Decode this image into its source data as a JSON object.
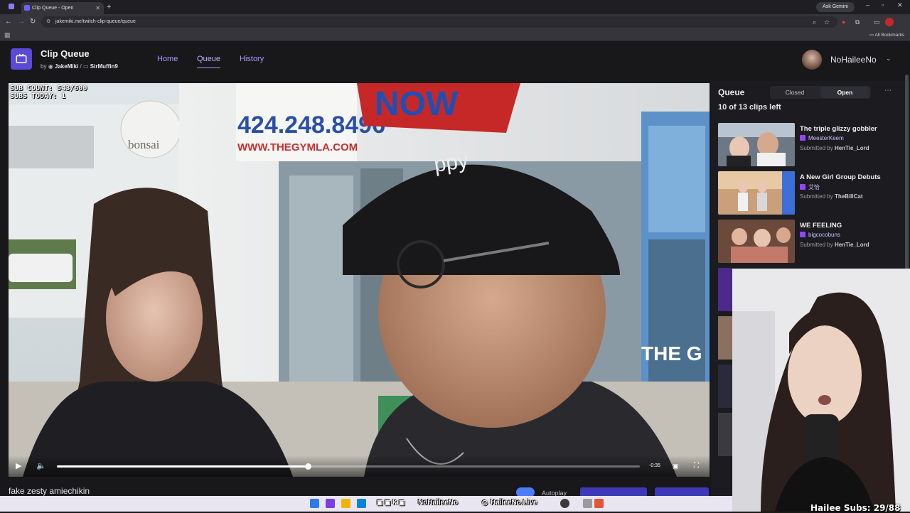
{
  "browser": {
    "tab_title": "Clip Queue - Open",
    "url": "jakemiki.me/twitch-clip-queue/queue",
    "gemini_label": "Ask Gemini",
    "bookmarks_label": "All Bookmarks"
  },
  "app": {
    "title": "Clip Queue",
    "by_prefix": "by",
    "author1": "JakeMiki",
    "separator": "/",
    "author2": "SirMuffin9",
    "nav": [
      "Home",
      "Queue",
      "History"
    ],
    "active_nav": "Queue",
    "username": "NoHaileeNo"
  },
  "video": {
    "overlay_line1": "SUB COUNT: 543/600",
    "overlay_line2": "SUBS TODAY: 1",
    "time_remaining": "-0:35",
    "progress": 0.43,
    "clip_title": "fake zesty amiechikin",
    "autoplay_label": "Autoplay",
    "sign_text1": "424.248.8496",
    "sign_text2": "WWW.THEGYMLA.COM",
    "sign_text3": "NOW",
    "sign_text4": "bonsai",
    "hat_text": "ppy",
    "window_text": "THE G"
  },
  "queue": {
    "title": "Queue",
    "closed_label": "Closed",
    "open_label": "Open",
    "count_text": "10 of 13 clips left",
    "submitted_by_prefix": "Submitted by",
    "clips": [
      {
        "title": "The triple glizzy gobbler",
        "channel": "MeesterKeem",
        "submitter": "HenTie_Lord"
      },
      {
        "title": "A New Girl Group Debuts",
        "channel": "艾怡",
        "submitter": "TheBillCat"
      },
      {
        "title": "WE FEELING",
        "channel": "bigcocobuns",
        "submitter": "HenTie_Lord"
      }
    ]
  },
  "webcam": {
    "label": "Hailee Subs: 29/88"
  },
  "taskbar": {
    "handle1": "NoHaileeNo",
    "handle2": "HaileeNo.Live"
  }
}
